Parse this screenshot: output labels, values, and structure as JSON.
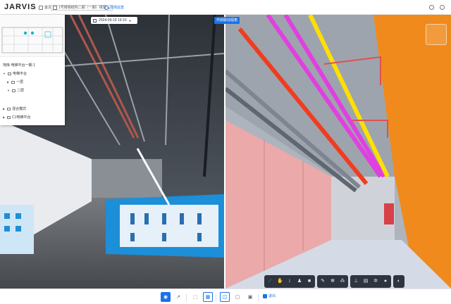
{
  "header": {
    "logo": "JARVIS",
    "home_label": "首页",
    "project_label": "1号楼钢结构二期（一期）楼层",
    "check_label": "现场巡查"
  },
  "date_picker": {
    "value": "2024-09-19 19:10"
  },
  "sync_button": {
    "label": "开启联动视角"
  },
  "tree": {
    "root_label": "地库·电梯平台一期 1",
    "items": [
      {
        "label": "电梯平台",
        "level": 0
      },
      {
        "label": "一层",
        "level": 1
      },
      {
        "label": "二层",
        "level": 1
      },
      {
        "label": "混合模式",
        "level": 0
      },
      {
        "label": "C1电梯平台",
        "level": 0
      }
    ]
  },
  "toolbar": {
    "icons": [
      "measure-icon",
      "hand-icon",
      "updown-arrow-icon",
      "person-icon",
      "camera-icon",
      "pen-icon",
      "nodes-icon",
      "group-icon",
      "tree-icon",
      "doc-icon",
      "gear-icon",
      "globe-icon"
    ]
  },
  "bottombar": {
    "exit_label": "退出"
  },
  "colors": {
    "accent": "#1a73e8",
    "toolbar_bg": "#2e3440"
  }
}
